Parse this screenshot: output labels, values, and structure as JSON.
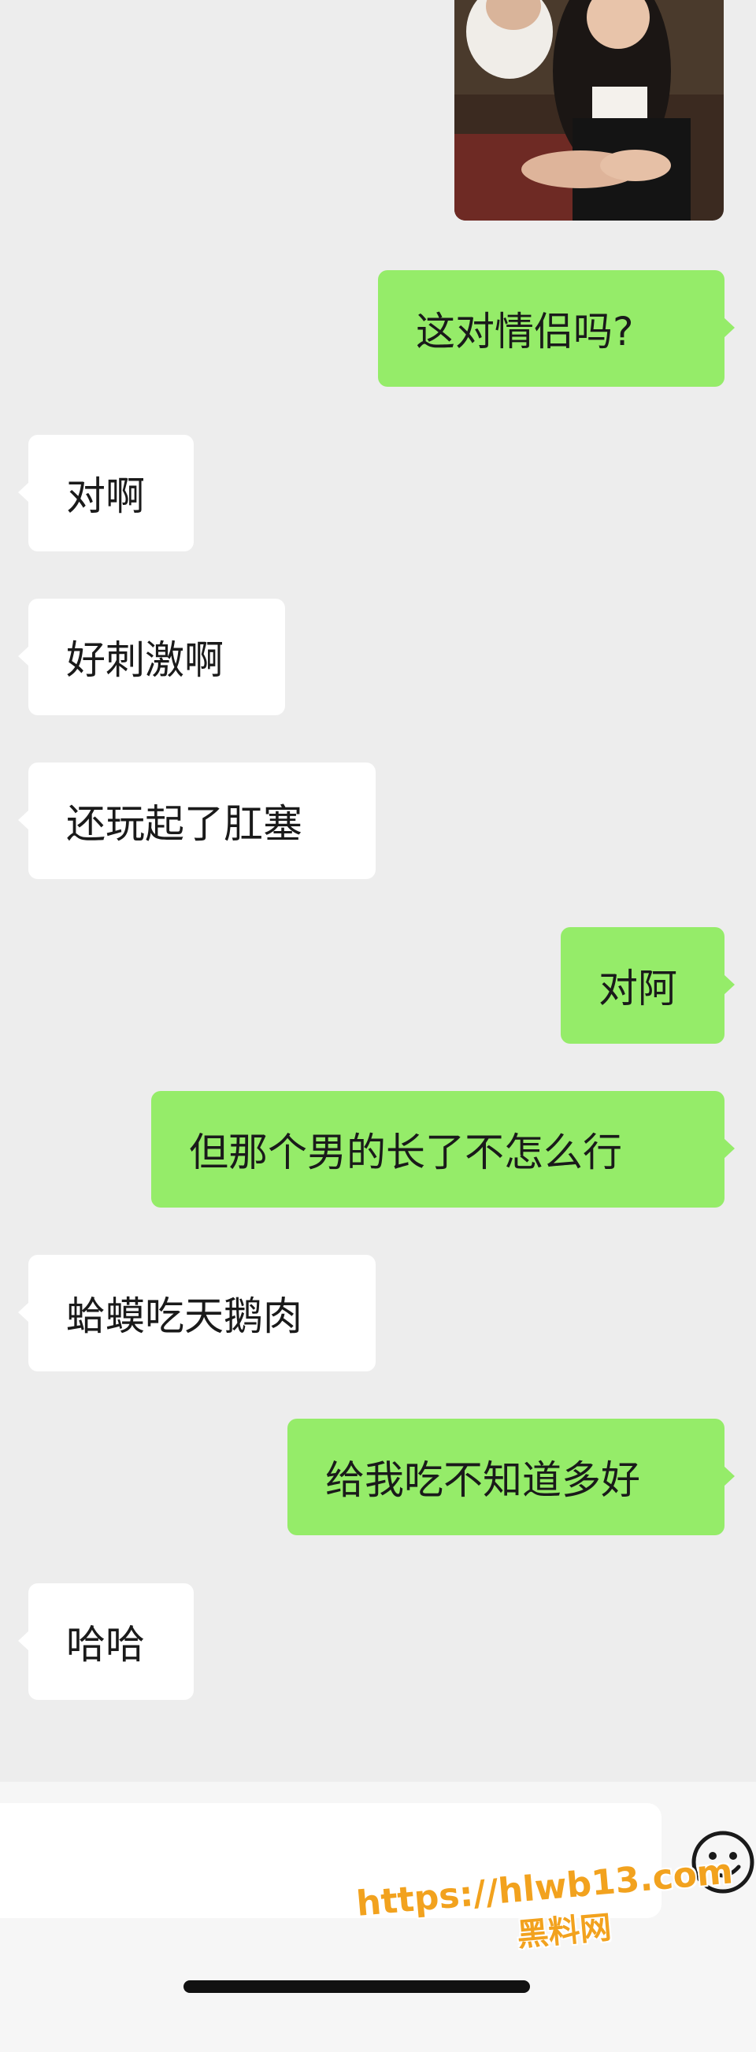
{
  "messages": [
    {
      "side": "out",
      "type": "image"
    },
    {
      "side": "out",
      "text": "这对情侣吗?"
    },
    {
      "side": "in",
      "text": "对啊"
    },
    {
      "side": "in",
      "text": "好刺激啊"
    },
    {
      "side": "in",
      "text": "还玩起了肛塞"
    },
    {
      "side": "out",
      "text": "对阿"
    },
    {
      "side": "out",
      "text": "但那个男的长了不怎么行"
    },
    {
      "side": "in",
      "text": "蛤蟆吃天鹅肉"
    },
    {
      "side": "out",
      "text": "给我吃不知道多好"
    },
    {
      "side": "in",
      "text": "哈哈"
    }
  ],
  "input_bar": {
    "placeholder": "",
    "emoji_icon": "smiley-face-icon"
  },
  "watermark": {
    "url": "https://hlwb13.com",
    "name": "黑料网"
  },
  "colors": {
    "chat_background": "#ededed",
    "incoming_bubble": "#ffffff",
    "outgoing_bubble": "#95ec69",
    "watermark": "#f2a21e"
  }
}
